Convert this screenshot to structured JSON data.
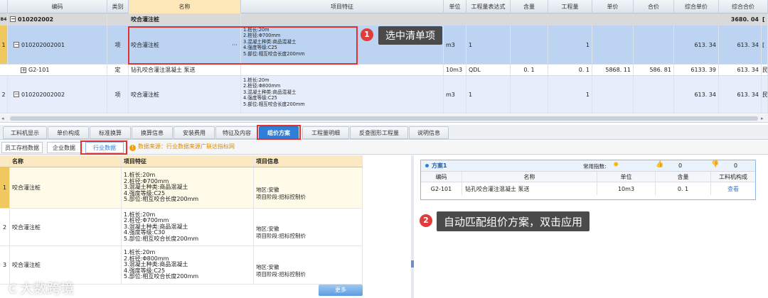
{
  "top_grid": {
    "headers": [
      "编码",
      "类别",
      "名称",
      "项目特征",
      "单位",
      "工程量表达式",
      "含量",
      "工程量",
      "单价",
      "合价",
      "综合单价",
      "综合合价"
    ],
    "group_row": {
      "index": "B4",
      "code": "010202002",
      "name": "咬合灌注桩",
      "total": "3680. 04",
      "tail": "["
    },
    "rows": [
      {
        "index": "1",
        "code": "010202002001",
        "type": "项",
        "name": "咬合灌注桩",
        "name_more": "···",
        "features": "1.桩长:20m\n2.桩径:Φ700mm\n3.混凝土种类:商品混凝土\n4.强度等级:C25\n5.部位:相互咬合长度200mm",
        "unit": "m3",
        "expr": "1",
        "content": "",
        "qty": "1",
        "price": "",
        "amount": "",
        "unit_total": "613. 34",
        "total": "613. 34",
        "tail": "["
      },
      {
        "index": "",
        "code": "G2-101",
        "type": "定",
        "name": "钻孔咬合灌注混凝土 泵送",
        "features": "",
        "unit": "10m3",
        "expr": "QDL",
        "content": "0. 1",
        "qty": "0. 1",
        "price": "5868. 11",
        "amount": "586. 81",
        "unit_total": "6133. 39",
        "total": "613. 34",
        "tail": "民"
      },
      {
        "index": "2",
        "code": "010202002002",
        "type": "项",
        "name": "咬合灌注桩",
        "features": "1.桩长:20m\n2.桩径:Φ800mm\n3.混凝土种类:商品混凝土\n4.强度等级:C25\n5.部位:相互咬合长度200mm",
        "unit": "m3",
        "expr": "1",
        "content": "",
        "qty": "1",
        "price": "",
        "amount": "",
        "unit_total": "613. 34",
        "total": "613. 34",
        "tail": "民"
      }
    ]
  },
  "callouts": [
    {
      "badge": "1",
      "text": "选中清单项"
    },
    {
      "badge": "2",
      "text": "自动匹配组价方案，双击应用"
    }
  ],
  "tabs": [
    "工料机显示",
    "单价构成",
    "标准换算",
    "换算信息",
    "安装费用",
    "特征及内容",
    "组价方案",
    "工程量明细",
    "反查图形工程量",
    "说明信息"
  ],
  "subtabs": [
    "员工存档数据",
    "企业数据",
    "行业数据"
  ],
  "source_note": "数据来源：行业数据来源广联达指标网",
  "bottom_grid": {
    "headers": [
      "名称",
      "项目特征",
      "项目信息"
    ],
    "rows": [
      {
        "index": "1",
        "name": "咬合灌注桩",
        "features": "1.桩长:20m\n2.桩径:Φ700mm\n3.混凝土种类:商品混凝土\n4.强度等级:C25\n5.部位:相互咬合长度200mm",
        "info": "地区:安徽\n项目阶段:招标控制价"
      },
      {
        "index": "2",
        "name": "咬合灌注桩",
        "features": "1.桩长:20m\n2.桩径:Φ700mm\n3.混凝土种类:商品混凝土\n4.强度等级:C30\n5.部位:相互咬合长度200mm",
        "info": "地区:安徽\n项目阶段:招标控制价"
      },
      {
        "index": "3",
        "name": "咬合灌注桩",
        "features": "1.桩长:20m\n2.桩径:Φ800mm\n3.混凝土种类:商品混凝土\n4.强度等级:C25\n5.部位:相互咬合长度200mm",
        "info": "地区:安徽\n项目阶段:招标控制价"
      }
    ],
    "more_label": "更多"
  },
  "plan": {
    "title": "方案1",
    "usage_label": "常用指数:",
    "likes": "0",
    "dislikes": "0",
    "columns": [
      "编码",
      "名称",
      "单位",
      "含量",
      "工料机构成"
    ],
    "row": {
      "code": "G2-101",
      "name": "钻孔咬合灌注混凝土 泵送",
      "unit": "10m3",
      "content": "0. 1",
      "action": "查看"
    }
  },
  "watermark": "大数跨境",
  "colors": {
    "selection": "#bcd4f2",
    "accent": "#2f7fd8",
    "callout_bg": "#4a4a4a",
    "badge": "#e23b3b",
    "highlight_box": "#e0332f"
  }
}
